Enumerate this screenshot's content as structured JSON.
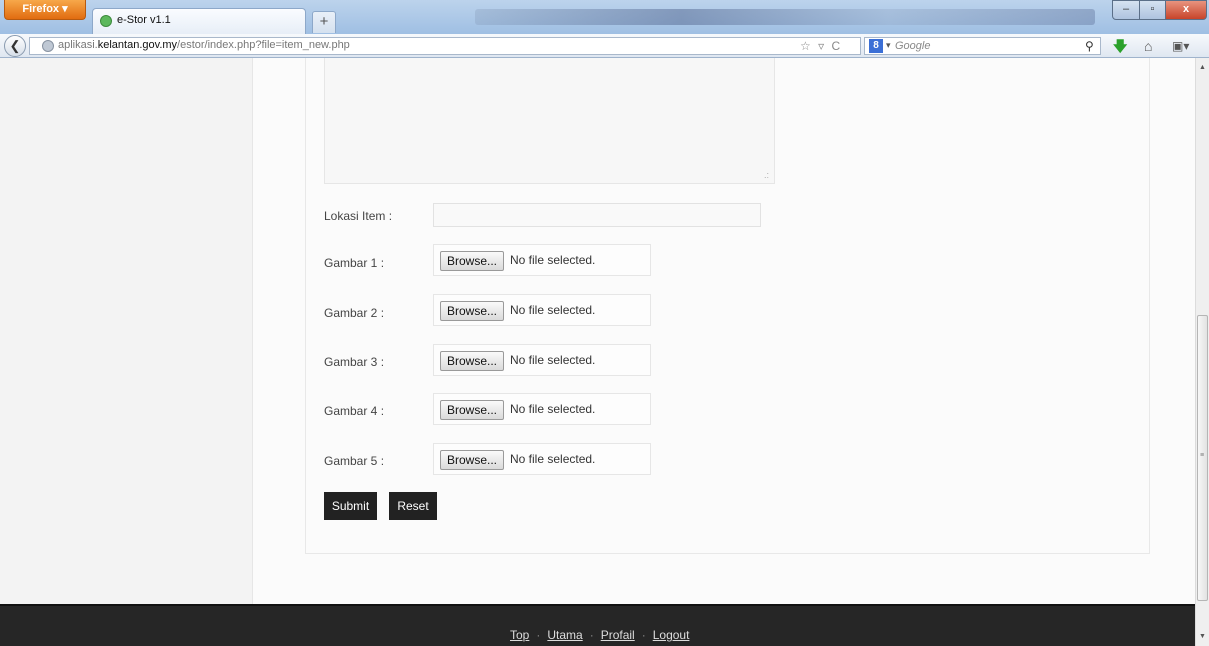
{
  "browser": {
    "menu_button": "Firefox ▾",
    "tab_title": "e-Stor v1.1",
    "new_tab": "+",
    "url_host": "aplikasi.",
    "url_domain": "kelantan.gov.my",
    "url_path": "/estor/index.php?file=item_new.php",
    "url_icons": "☆ ▿ C",
    "search_engine": "8",
    "search_placeholder": "Google",
    "window_min": "–",
    "window_max": "▫",
    "window_close": "x"
  },
  "form": {
    "lokasi_label": "Lokasi Item :",
    "lokasi_value": "",
    "image_fields": [
      {
        "label": "Gambar 1 :",
        "browse": "Browse...",
        "status": "No file selected."
      },
      {
        "label": "Gambar 2 :",
        "browse": "Browse...",
        "status": "No file selected."
      },
      {
        "label": "Gambar 3 :",
        "browse": "Browse...",
        "status": "No file selected."
      },
      {
        "label": "Gambar 4 :",
        "browse": "Browse...",
        "status": "No file selected."
      },
      {
        "label": "Gambar 5 :",
        "browse": "Browse...",
        "status": "No file selected."
      }
    ],
    "submit_label": "Submit",
    "reset_label": "Reset"
  },
  "footer": {
    "links": [
      "Top",
      "Utama",
      "Profail",
      "Logout"
    ],
    "separator": "·"
  }
}
